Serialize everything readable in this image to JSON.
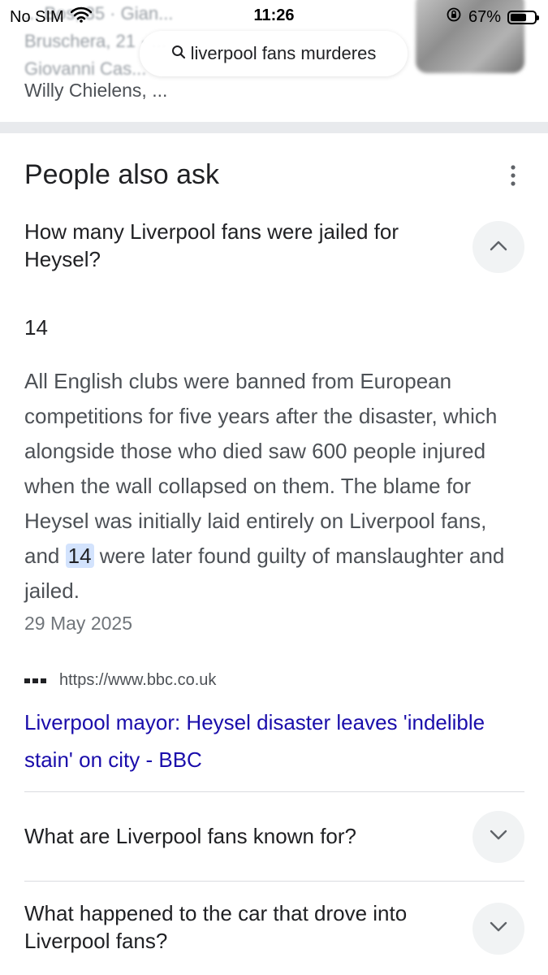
{
  "status_bar": {
    "carrier": "No SIM",
    "time": "11:26",
    "battery_percent": "67%",
    "battery_level": 0.67
  },
  "search": {
    "query": "liverpool fans murderes"
  },
  "previous_result": {
    "blurred_lines": [
      "... Bos, 35 · Gian...",
      "Bruschera, 21 · ...",
      "Giovanni Cas..."
    ],
    "tail_text": "Willy Chielens, ..."
  },
  "people_also_ask": {
    "title": "People also ask",
    "expanded": {
      "question": "How many Liverpool fans were jailed for Heysel?",
      "short_answer": "14",
      "body_before": "All English clubs were banned from European competitions for five years after the disaster, which alongside those who died saw 600 people injured when the wall collapsed on them. The blame for Heysel was initially laid entirely on Liverpool fans, and ",
      "body_highlight": "14",
      "body_after": " were later found guilty of manslaughter and jailed.",
      "date": "29 May 2025",
      "source_url": "https://www.bbc.co.uk",
      "source_title": "Liverpool mayor: Heysel disaster leaves 'indelible stain' on city - BBC"
    },
    "collapsed": [
      {
        "question": "What are Liverpool fans known for?"
      },
      {
        "question": "What happened to the car that drove into Liverpool fans?"
      }
    ]
  },
  "colors": {
    "link": "#1a0dab",
    "highlight": "#d3e3fd",
    "chip_bg": "#f1f3f4",
    "section_band": "#e8eaed"
  },
  "icons": [
    "wifi-icon",
    "orientation-lock-icon",
    "battery-icon",
    "search-icon",
    "more-vert-icon",
    "chevron-up-icon",
    "chevron-down-icon",
    "favicon-icon"
  ]
}
